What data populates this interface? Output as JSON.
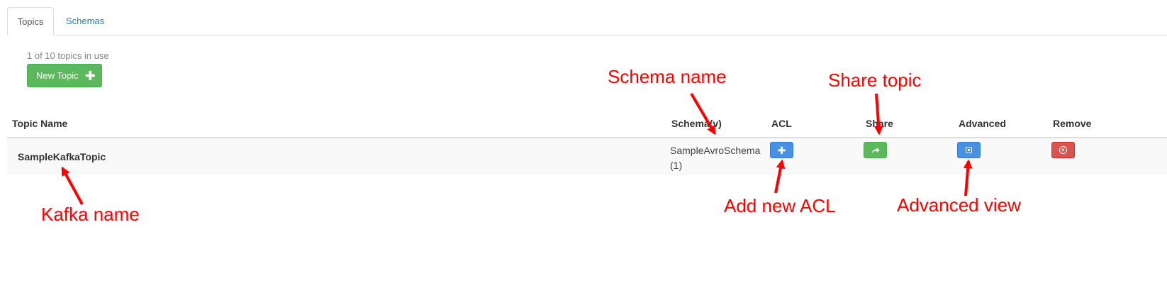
{
  "tabs": [
    {
      "label": "Topics",
      "active": true
    },
    {
      "label": "Schemas",
      "active": false
    }
  ],
  "usage_text": "1 of 10 topics in use",
  "new_topic_button": {
    "label": "New Topic",
    "icon": "plus-icon"
  },
  "table": {
    "columns": [
      "Topic Name",
      "Schema(v)",
      "ACL",
      "Share",
      "Advanced",
      "Remove"
    ],
    "rows": [
      {
        "topic_name": "SampleKafkaTopic",
        "schema_name": "SampleAvroSchema",
        "schema_version": "(1)",
        "acl_icon": "plus-icon",
        "share_icon": "share-icon",
        "advanced_icon": "advanced-view-icon",
        "remove_icon": "remove-icon"
      }
    ]
  },
  "annotations": {
    "schema_name": "Schema name",
    "share_topic": "Share topic",
    "kafka_name": "Kafka name",
    "add_new_acl": "Add new ACL",
    "advanced_view": "Advanced  view"
  },
  "colors": {
    "annotation": "#ff0000",
    "success": "#5cb85c",
    "primary": "#4a90e2",
    "danger": "#d9534f",
    "link": "#337ab7"
  }
}
